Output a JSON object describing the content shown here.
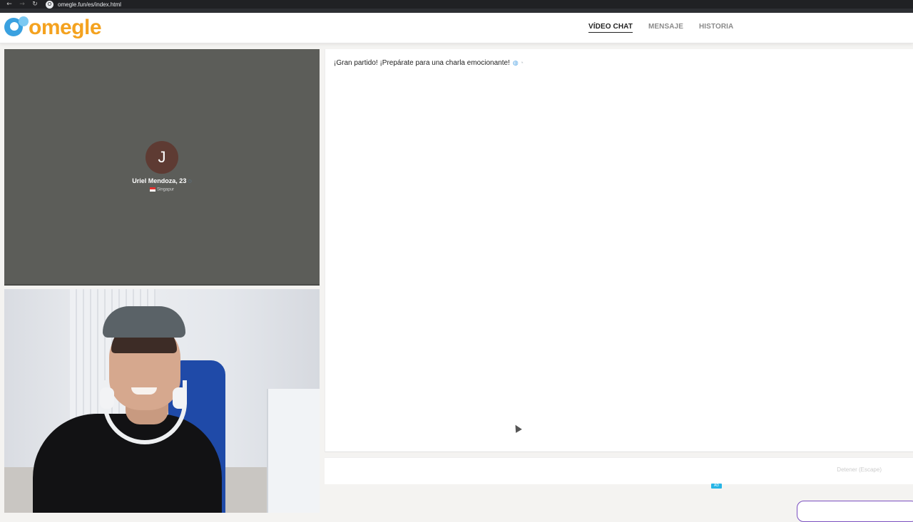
{
  "browser": {
    "url": "omegle.fun/es/index.html",
    "url_icon": "O"
  },
  "header": {
    "logo_text": "omegle",
    "nav": [
      {
        "label": "VÍDEO CHAT",
        "active": true
      },
      {
        "label": "MENSAJE",
        "active": false
      },
      {
        "label": "HISTORIA",
        "active": false
      }
    ]
  },
  "stranger": {
    "avatar_initial": "J",
    "name": "Uriel Mendoza, 23",
    "country": "Singapur",
    "verified_icon": "verified-badge-icon"
  },
  "chat": {
    "messages": [
      {
        "text": "¡Gran partido! ¡Prepárate para una charla emocionante!"
      }
    ]
  },
  "controls": {
    "stop_label": "Detener (Escape)",
    "ad_label": "AD"
  },
  "colors": {
    "logo_orange": "#f4a21f",
    "logo_blue": "#3aa1e0",
    "stranger_panel": "#5c5d59",
    "promo_border": "#7a4fc0"
  }
}
